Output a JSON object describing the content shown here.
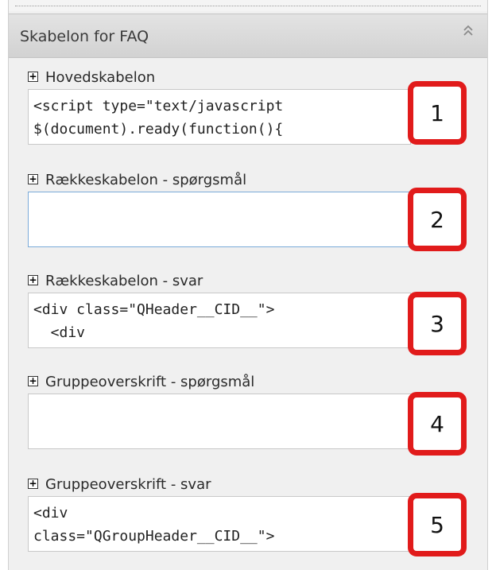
{
  "panel": {
    "title": "Skabelon for FAQ",
    "collapse_icon": "double-chevron-up-icon"
  },
  "sections": [
    {
      "label": "Hovedskabelon",
      "code": "<script type=\"text/javascript\n$(document).ready(function(){",
      "callout": "1"
    },
    {
      "label": "Rækkeskabelon - spørgsmål",
      "code": "",
      "callout": "2"
    },
    {
      "label": "Rækkeskabelon - svar",
      "code": "<div class=\"QHeader__CID__\">\n  <div",
      "callout": "3"
    },
    {
      "label": "Gruppeoverskrift - spørgsmål",
      "code": "",
      "callout": "4"
    },
    {
      "label": "Gruppeoverskrift - svar",
      "code": "<div\nclass=\"QGroupHeader__CID__\">",
      "callout": "5"
    }
  ],
  "colors": {
    "callout_border": "#e11b1b",
    "header_bg": "#d9d9d9",
    "panel_bg": "#f0f0f0"
  }
}
